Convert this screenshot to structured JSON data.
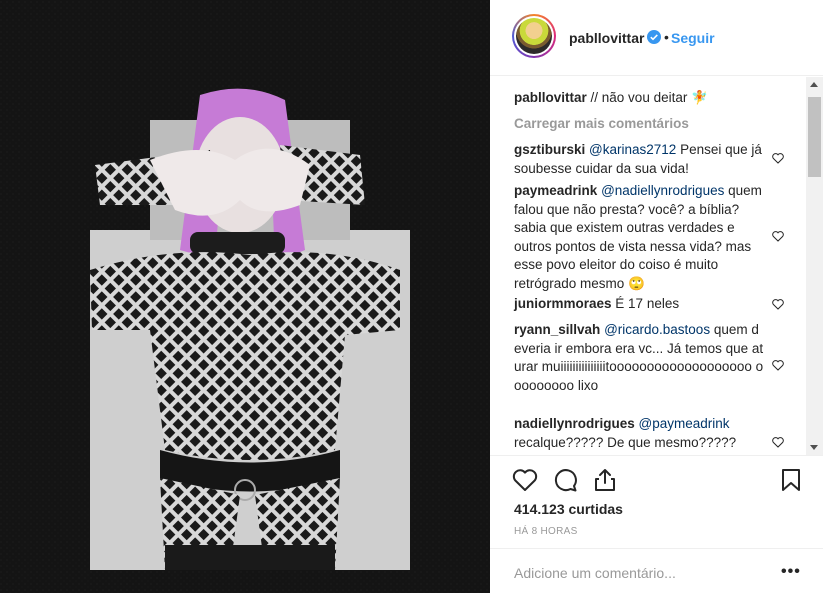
{
  "post": {
    "username": "pabllovittar",
    "follow_label": "Seguir",
    "dot": "•",
    "caption_text": "// não vou deitar 🧚"
  },
  "comments": {
    "load_more": "Carregar mais comentários",
    "items": [
      {
        "user": "gsztiburski",
        "mention": "@karinas2712",
        "text": "Pensei que já soubesse cuidar da sua vida!"
      },
      {
        "user": "paymeadrink",
        "mention": "@nadiellynrodrigues",
        "text": "quem falou que não presta? você? a bíblia? sabia que existem outras verdades e outros pontos de vista nessa vida? mas esse povo eleitor do coiso é muito retrógrado mesmo 🙄"
      },
      {
        "user": "juniormmoraes",
        "mention": "",
        "text": "É 17 neles"
      },
      {
        "user": "ryann_sillvah",
        "mention": "@ricardo.bastoos",
        "text": "quem deveria ir embora era vc... Já temos que aturar muiiiiiiiiiiiiiiitooooooooooooooooooo ooooooooo lixo"
      },
      {
        "user": "nadiellynrodrigues",
        "mention": "@paymeadrink",
        "text": "recalque????? De que mesmo?????"
      }
    ]
  },
  "stats": {
    "likes": "414.123 curtidas",
    "time": "HÁ 8 HORAS"
  },
  "composer": {
    "placeholder": "Adicione um comentário...",
    "more": "•••"
  },
  "icons": [
    "verified-icon",
    "heart-icon",
    "comment-icon",
    "share-icon",
    "bookmark-icon",
    "like-comment-icon"
  ],
  "colors": {
    "link": "#3897f0",
    "mention": "#003569",
    "muted": "#999999",
    "text": "#262626",
    "photo_bg": "#111111",
    "hair": "#c67bd6"
  }
}
